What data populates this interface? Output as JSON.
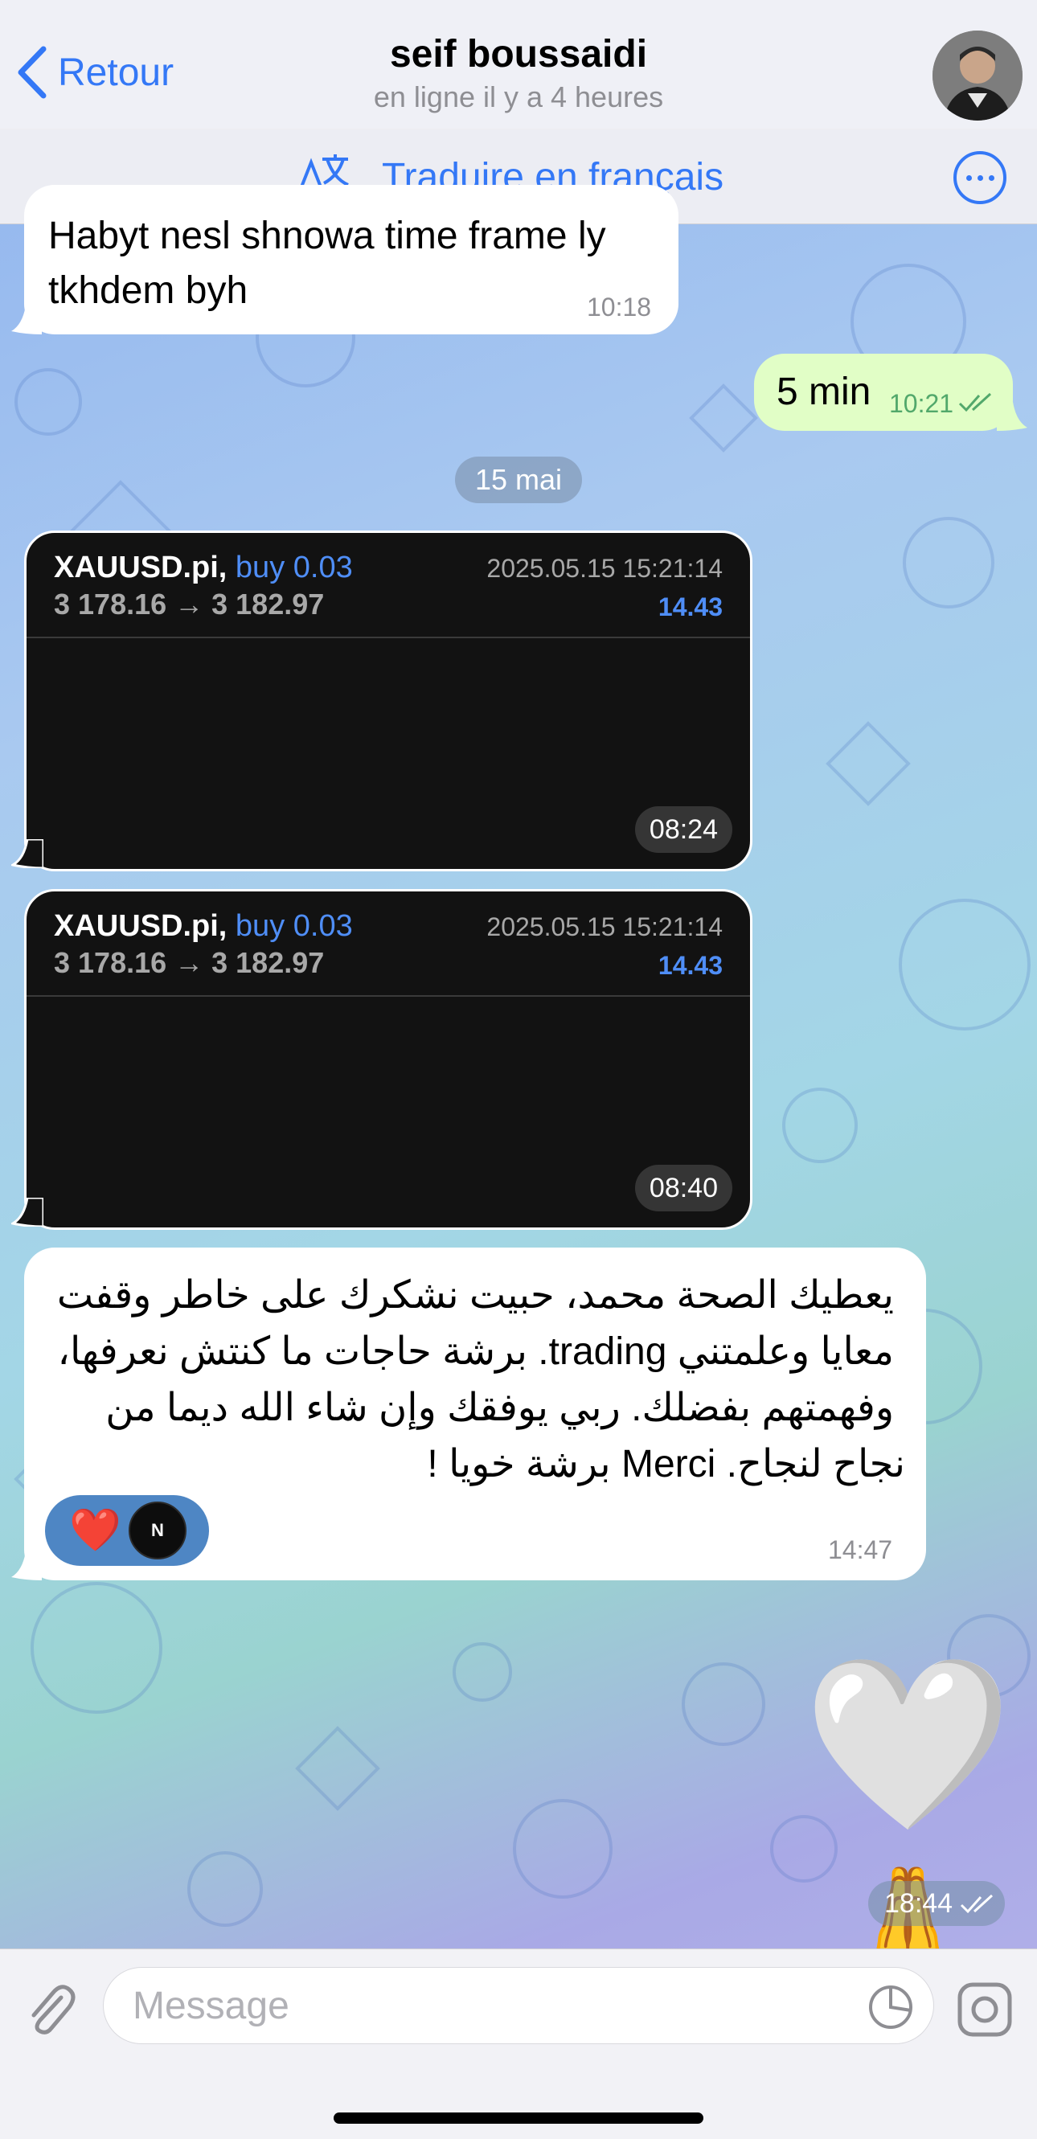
{
  "header": {
    "back_label": "Retour",
    "contact_name": "seif boussaidi",
    "status": "en ligne il y a 4 heures",
    "translate_label": "Traduire en français"
  },
  "messages": {
    "m1": {
      "text_line1": "Habyt nesl shnowa time frame ly",
      "text_line2": "tkhdem byh",
      "time": "10:18"
    },
    "m2": {
      "text": "5 min",
      "time": "10:21"
    },
    "date_separator": "15 mai",
    "shot1": {
      "symbol": "XAUUSD.pi,",
      "action": "buy 0.03",
      "prices": "3 178.16 → 3 182.97",
      "datetime": "2025.05.15 15:21:14",
      "profit": "14.43",
      "time": "08:24"
    },
    "shot2": {
      "symbol": "XAUUSD.pi,",
      "action": "buy 0.03",
      "prices": "3 178.16 → 3 182.97",
      "datetime": "2025.05.15 15:21:14",
      "profit": "14.43",
      "time": "08:40"
    },
    "m3": {
      "line1": "يعطيك الصحة محمد، حبيت نشكرك على خاطر وقفت",
      "line2": "معايا وعلمتني trading. برشة حاجات ما كنتش نعرفها،",
      "line3": "وفهمتهم بفضلك. ربي يوفقك وإن شاء الله ديما من",
      "line4": "نجاح لنجاح. Merci برشة خويا !",
      "time": "14:47",
      "reaction_emoji": "❤️",
      "reaction_avatar_text": "N"
    },
    "m4": {
      "emoji": "🤍🙏",
      "time": "18:44"
    }
  },
  "input": {
    "placeholder": "Message"
  },
  "colors": {
    "accent": "#3478f6",
    "outgoing_bubble": "#e1fec6",
    "check": "#52a86b"
  }
}
